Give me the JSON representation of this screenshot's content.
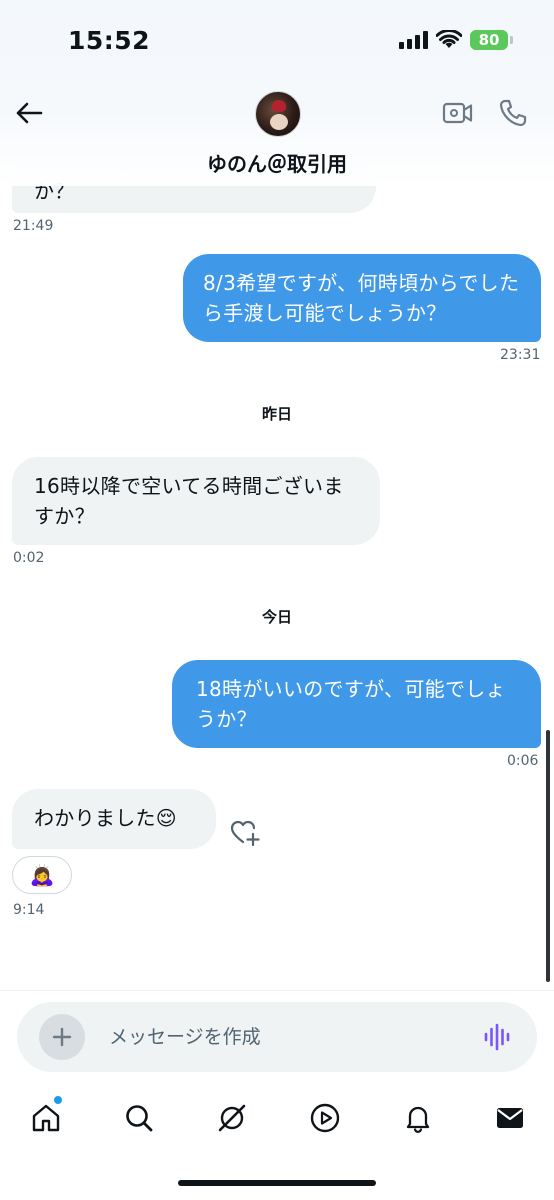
{
  "status_bar": {
    "time": "15:52",
    "battery": "80"
  },
  "header": {
    "contact_name": "ゆのん＠取引用"
  },
  "messages": [
    {
      "direction": "in",
      "text": "か？",
      "time": "21:49"
    },
    {
      "direction": "out",
      "text": "8/3希望ですが、何時頃からでしたら手渡し可能でしょうか？",
      "time": "23:31"
    },
    {
      "day": "昨日"
    },
    {
      "direction": "in",
      "text": "16時以降で空いてる時間ございますか？",
      "time": "0:02"
    },
    {
      "day": "今日"
    },
    {
      "direction": "out",
      "text": "18時がいいのですが、可能でしょうか？",
      "time": "0:06"
    },
    {
      "direction": "in",
      "text": "わかりました😌",
      "reaction": "🙇‍♀️",
      "time": "9:14"
    }
  ],
  "composer": {
    "placeholder": "メッセージを作成"
  },
  "nav": [
    "home-icon",
    "search-icon",
    "grok-icon",
    "video-icon",
    "notifications-icon",
    "messages-icon"
  ],
  "colors": {
    "outgoing_bubble": "#3f98e8",
    "incoming_bubble": "#eff3f4",
    "accent": "#1d9bf0",
    "voice": "#7856ff"
  }
}
